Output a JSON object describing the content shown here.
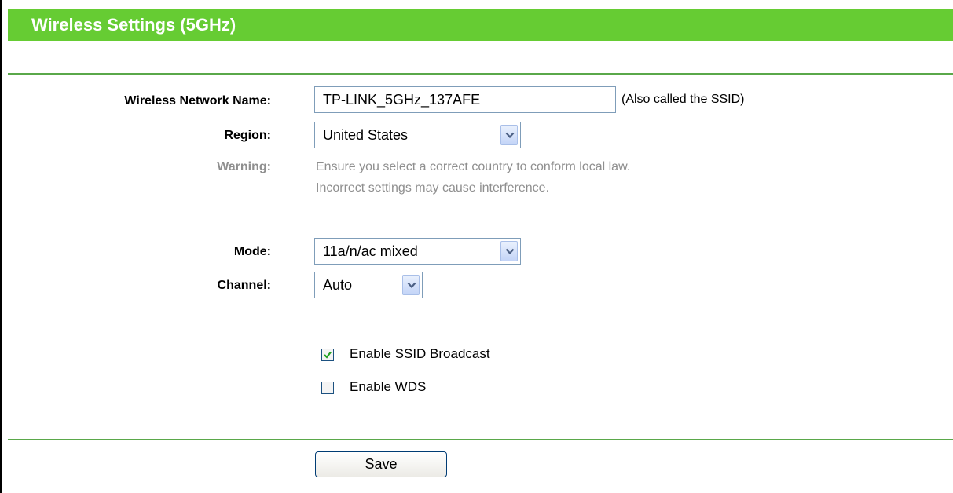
{
  "header": {
    "title": "Wireless Settings (5GHz)"
  },
  "form": {
    "ssid": {
      "label": "Wireless Network Name:",
      "value": "TP-LINK_5GHz_137AFE",
      "hint": "(Also called the SSID)"
    },
    "region": {
      "label": "Region:",
      "value": "United States"
    },
    "warning": {
      "label": "Warning:",
      "line1": "Ensure you select a correct country to conform local law.",
      "line2": "Incorrect settings may cause interference."
    },
    "mode": {
      "label": "Mode:",
      "value": "11a/n/ac mixed"
    },
    "channel": {
      "label": "Channel:",
      "value": "Auto"
    },
    "ssid_broadcast": {
      "label": "Enable SSID Broadcast",
      "checked": true
    },
    "wds": {
      "label": "Enable WDS",
      "checked": false
    }
  },
  "actions": {
    "save_label": "Save"
  },
  "colors": {
    "header_bg": "#66cc33",
    "divider": "#5aa84a",
    "warning_text": "#8f8f8f"
  }
}
